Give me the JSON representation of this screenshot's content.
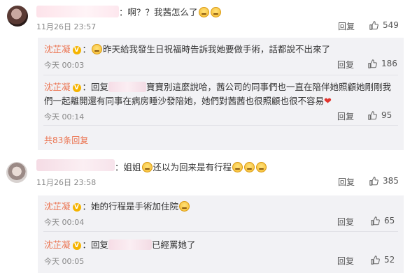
{
  "comment1": {
    "text": "：啊？？我茜怎么了",
    "date": "11月26日 23:57",
    "reply_label": "回复",
    "likes": "549",
    "replies": [
      {
        "author": "沈芷凝",
        "text_before": "：",
        "text": "昨天給我發生日祝福時告訴我她要做手術，話都說不出來了",
        "time": "今天 00:03",
        "reply_label": "回复",
        "likes": "186"
      },
      {
        "author": "沈芷凝",
        "text_before": "：回复",
        "text_line1": "寶寶別這麼說哈，茜公司的同事們也一直在陪伴她照顧她剛剛我",
        "text_line2": "們一起離開還有同事在病房睡沙發陪她，她們對茜茜也很照顧也很不容易",
        "time": "今天 00:14",
        "reply_label": "回复",
        "likes": "95"
      }
    ],
    "more_replies": "共83条回复"
  },
  "comment2": {
    "text_a": "：姐姐",
    "text_b": "还以为回来是有行程",
    "date": "11月26日 23:58",
    "reply_label": "回复",
    "likes": "385",
    "replies": [
      {
        "author": "沈芷凝",
        "text_before": "：",
        "text": "她的行程是手術加住院",
        "time": "今天 00:04",
        "reply_label": "回复",
        "likes": "65"
      },
      {
        "author": "沈芷凝",
        "text_before": "：回复",
        "text": "已經罵她了",
        "time": "今天 00:05",
        "reply_label": "回复",
        "likes": "52"
      }
    ]
  }
}
